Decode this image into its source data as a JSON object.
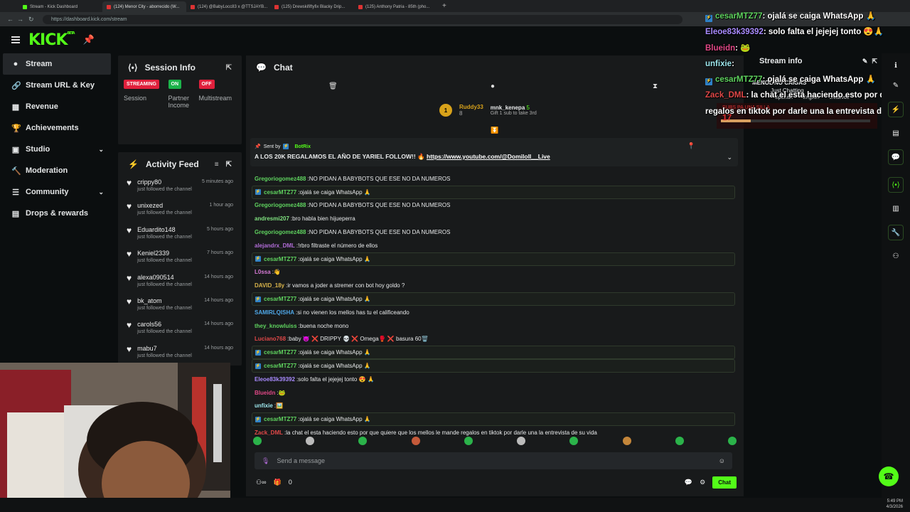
{
  "browser": {
    "tabs": [
      "Stream - Kick Dashboard",
      "(124) Menor City - aborrecido (W...",
      "(124) @BabyLocc83 x @TTSJAYB...",
      "(125) Drewskififtyfix Blacky Drip...",
      "(125) Anthony Patria - 85th (pho..."
    ],
    "new_tab": "+",
    "url": "https://dashboard.kick.com/stream"
  },
  "brand": {
    "logo": "KICK",
    "beta": "BETA",
    "accent": "#53fc18"
  },
  "sidebar": {
    "items": [
      {
        "label": "Stream",
        "icon": "radio-icon"
      },
      {
        "label": "Stream URL & Key",
        "icon": "link-icon"
      },
      {
        "label": "Revenue",
        "icon": "chart-icon"
      },
      {
        "label": "Achievements",
        "icon": "trophy-icon"
      },
      {
        "label": "Studio",
        "icon": "studio-icon"
      },
      {
        "label": "Moderation",
        "icon": "hammer-icon"
      },
      {
        "label": "Community",
        "icon": "community-icon"
      },
      {
        "label": "Drops & rewards",
        "icon": "gift-icon"
      }
    ]
  },
  "session": {
    "title": "Session Info",
    "cells": [
      {
        "badge": "STREAMING",
        "label": "Session",
        "color": "#e0203c"
      },
      {
        "badge": "ON",
        "label": "Partner Income",
        "color": "#1bb34a"
      },
      {
        "badge": "OFF",
        "label": "Multistream",
        "color": "#e0203c"
      }
    ]
  },
  "activity": {
    "title": "Activity Feed",
    "items": [
      {
        "name": "crippy80",
        "time": "5 minutes ago",
        "sub": "just followed the channel"
      },
      {
        "name": "unixezed",
        "time": "1 hour ago",
        "sub": "just followed the channel"
      },
      {
        "name": "Eduardito148",
        "time": "5 hours ago",
        "sub": "just followed the channel"
      },
      {
        "name": "Keniel2339",
        "time": "7 hours ago",
        "sub": "just followed the channel"
      },
      {
        "name": "alexa090514",
        "time": "14 hours ago",
        "sub": "just followed the channel"
      },
      {
        "name": "bk_atom",
        "time": "14 hours ago",
        "sub": "just followed the channel"
      },
      {
        "name": "carols56",
        "time": "14 hours ago",
        "sub": "just followed the channel"
      },
      {
        "name": "mabu7",
        "time": "14 hours ago",
        "sub": "just followed the channel"
      }
    ]
  },
  "chat": {
    "title": "Chat",
    "gifter": {
      "name": "Ruddy33",
      "count": "8",
      "rank": "1"
    },
    "gift": {
      "user": "mnk_kenepa",
      "count": "5",
      "text": "Gift 1 sub to take 3rd"
    },
    "pinned": {
      "sent_by": "Sent by",
      "bot": "BotRix",
      "text": "A LOS 20K REGALAMOS EL AÑO DE YARIEL FOLLOW!! 🔥",
      "link": "https://www.youtube.com/@Domiloll__Live"
    },
    "messages": [
      {
        "user": "Gregoriogomez488",
        "text": "NO PIDAN A BABYBOTS QUE ESE NO DA NUMEROS",
        "color": "#5fd35f",
        "hl": false
      },
      {
        "user": "cesarMTZ77",
        "text": "ojalá se caiga WhatsApp 🙏",
        "color": "#5fd35f",
        "hl": true
      },
      {
        "user": "Gregoriogomez488",
        "text": "NO PIDAN A BABYBOTS QUE ESE NO DA NUMEROS",
        "color": "#5fd35f",
        "hl": false
      },
      {
        "user": "andresmi207",
        "text": "bro habla bien hijueperra",
        "color": "#7fe07f",
        "hl": false
      },
      {
        "user": "Gregoriogomez488",
        "text": "NO PIDAN A BABYBOTS QUE ESE NO DA NUMEROS",
        "color": "#5fd35f",
        "hl": false
      },
      {
        "user": "alejandrx_DML",
        "text": "!rbro filtraste el número de ellos",
        "color": "#b06cd6",
        "hl": false
      },
      {
        "user": "cesarMTZ77",
        "text": "ojalá se caiga WhatsApp 🙏",
        "color": "#5fd35f",
        "hl": true
      },
      {
        "user": "L0ssa",
        "text": "👋",
        "color": "#d77bd6",
        "hl": false
      },
      {
        "user": "DAVID_18y",
        "text": "ir vamos a joder a stremer con bot hoy goldo ?",
        "color": "#d8b34a",
        "hl": false
      },
      {
        "user": "cesarMTZ77",
        "text": "ojalá se caiga WhatsApp 🙏",
        "color": "#5fd35f",
        "hl": true
      },
      {
        "user": "SAMIRLQISHA",
        "text": "si no vienen los mellos has tu el calificeando",
        "color": "#4fa8e8",
        "hl": false
      },
      {
        "user": "they_knowluiss",
        "text": "buena noche mono",
        "color": "#5fd35f",
        "hl": false
      },
      {
        "user": "Luciano768",
        "text": "baby 😈 ❌ DRIPPY 💀 ❌ Omega🥊 ❌ basura 60🗑️",
        "color": "#e04848",
        "hl": false
      },
      {
        "user": "cesarMTZ77",
        "text": "ojalá se caiga WhatsApp 🙏",
        "color": "#5fd35f",
        "hl": true
      },
      {
        "user": "cesarMTZ77",
        "text": "ojalá se caiga WhatsApp 🙏",
        "color": "#5fd35f",
        "hl": true
      },
      {
        "user": "Eleoe83k39392",
        "text": "solo falta el jejejej tonto 😍 🙏",
        "color": "#a98bff",
        "hl": false
      },
      {
        "user": "Blueidn",
        "text": "🐸",
        "color": "#e04886",
        "hl": false
      },
      {
        "user": "unfixie",
        "text": "🖼️",
        "color": "#9ee8ee",
        "hl": false
      },
      {
        "user": "cesarMTZ77",
        "text": "ojalá se caiga WhatsApp 🙏",
        "color": "#5fd35f",
        "hl": true
      },
      {
        "user": "Zack_DML",
        "text": "la chat el esta haciendo esto por que quiere que los mellos le mande regalos en tiktok por darle una la entrevista de su vida",
        "color": "#e04848",
        "hl": false
      }
    ],
    "input_placeholder": "Send a message",
    "footer_count": "0",
    "send_label": "Chat"
  },
  "overlay": {
    "lines": [
      {
        "user": "cesarMTZ77",
        "text": ": ojalá se caiga WhatsApp 🙏",
        "color": "#5fd35f"
      },
      {
        "user": "Eleoe83k39392",
        "text": ": solo falta el jejejej tonto 😍🙏",
        "color": "#a98bff"
      },
      {
        "user": "Blueidn",
        "text": ": 🐸",
        "color": "#e04886"
      },
      {
        "user": "unfixie",
        "text": ":",
        "color": "#9ee8ee"
      },
      {
        "user": "cesarMTZ77",
        "text": ": ojalá se caiga WhatsApp 🙏",
        "color": "#5fd35f"
      },
      {
        "user": "Zack_DML",
        "text": ": la chat el esta haciendo esto por que",
        "color": "#e04848"
      },
      {
        "user": "",
        "text": "regalos en tiktok por darle una la entrevista de su vida",
        "color": "#ffffff"
      }
    ],
    "stream_info": "Stream info",
    "menor": "MENOL NO CAIGAS",
    "just_chatting": "Just Chatting",
    "langs": [
      "Spanish",
      "English",
      "creativos"
    ],
    "goal_label": "SUBS PA UNA SILLA",
    "goal_count": "17"
  },
  "clock": {
    "time": "5:49 PM",
    "date": "4/3/2026"
  }
}
